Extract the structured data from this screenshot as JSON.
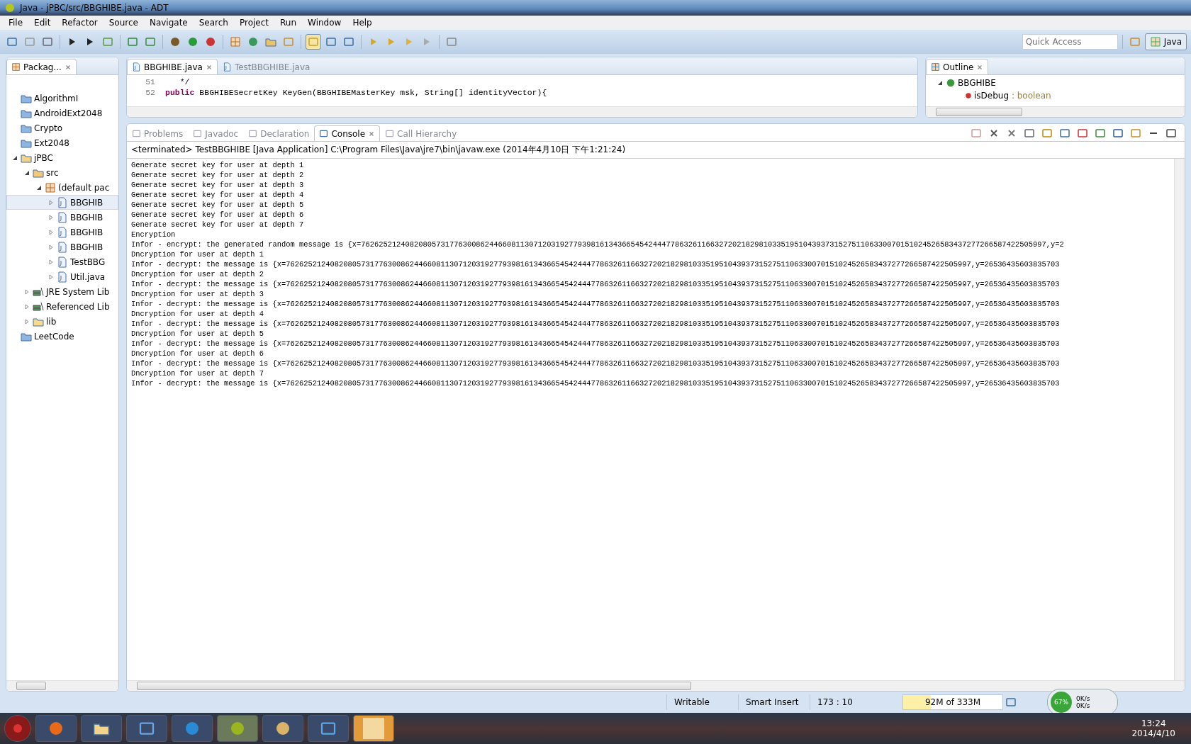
{
  "window": {
    "title": "Java - jPBC/src/BBGHIBE.java - ADT"
  },
  "menu": [
    "File",
    "Edit",
    "Refactor",
    "Source",
    "Navigate",
    "Search",
    "Project",
    "Run",
    "Window",
    "Help"
  ],
  "quick_access": {
    "placeholder": "Quick Access"
  },
  "perspective": {
    "label": "Java",
    "selected": true
  },
  "package_explorer": {
    "title": "Packag...",
    "tree": [
      {
        "label": "AlgorithmI",
        "kind": "project",
        "selected": false
      },
      {
        "label": "AndroidExt2048",
        "kind": "project",
        "selected": false
      },
      {
        "label": "Crypto",
        "kind": "project",
        "selected": false
      },
      {
        "label": "Ext2048",
        "kind": "project",
        "selected": false
      },
      {
        "label": "jPBC",
        "kind": "javaproject",
        "expanded": true,
        "selected": false,
        "children": [
          {
            "label": "src",
            "kind": "srcfolder",
            "expanded": true,
            "selected": false,
            "children": [
              {
                "label": "(default pac",
                "kind": "package",
                "expanded": true,
                "selected": false,
                "children": [
                  {
                    "label": "BBGHIB",
                    "kind": "java",
                    "expanded": false,
                    "selected": true
                  },
                  {
                    "label": "BBGHIB",
                    "kind": "java",
                    "expanded": false,
                    "selected": false
                  },
                  {
                    "label": "BBGHIB",
                    "kind": "java",
                    "expanded": false,
                    "selected": false
                  },
                  {
                    "label": "BBGHIB",
                    "kind": "java",
                    "expanded": false,
                    "selected": false
                  },
                  {
                    "label": "TestBBG",
                    "kind": "java",
                    "expanded": false,
                    "selected": false
                  },
                  {
                    "label": "Util.java",
                    "kind": "java",
                    "expanded": false,
                    "selected": false
                  }
                ]
              }
            ]
          },
          {
            "label": "JRE System Lib",
            "kind": "library",
            "expanded": false,
            "selected": false
          },
          {
            "label": "Referenced Lib",
            "kind": "library",
            "expanded": false,
            "selected": false
          },
          {
            "label": "lib",
            "kind": "folder",
            "expanded": false,
            "selected": false
          }
        ]
      },
      {
        "label": "LeetCode",
        "kind": "project",
        "selected": false
      }
    ]
  },
  "editor": {
    "tabs": [
      {
        "label": "BBGHIBE.java",
        "selected": true
      },
      {
        "label": "TestBBGHIBE.java",
        "selected": false
      }
    ],
    "lines": [
      {
        "number": "51",
        "code": "   */"
      },
      {
        "number": "52",
        "code": "**public** BBGHIBESecretKey KeyGen(BBGHIBEMasterKey msk, String[] identityVector){"
      }
    ]
  },
  "outline": {
    "title": "Outline",
    "tree": [
      {
        "label": "BBGHIBE",
        "kind": "class",
        "children": [
          {
            "label": "isDebug",
            "type": " : boolean",
            "kind": "field"
          }
        ]
      }
    ]
  },
  "console_panel": {
    "tabs": [
      {
        "label": "Problems",
        "selected": false
      },
      {
        "label": "Javadoc",
        "selected": false
      },
      {
        "label": "Declaration",
        "selected": false
      },
      {
        "label": "Console",
        "selected": true
      },
      {
        "label": "Call Hierarchy",
        "selected": false
      }
    ],
    "header": "<terminated> TestBBGHIBE [Java Application] C:\\Program Files\\Java\\jre7\\bin\\javaw.exe (2014年4月10日 下午1:21:24)",
    "lines": [
      "Generate secret key for user at depth 1",
      "Generate secret key for user at depth 2",
      "Generate secret key for user at depth 3",
      "Generate secret key for user at depth 4",
      "Generate secret key for user at depth 5",
      "Generate secret key for user at depth 6",
      "Generate secret key for user at depth 7",
      "Encryption",
      "Infor - encrypt: the generated random message is {x=76262521240820805731776300862446608113071203192779398161343665454244477863261166327202182981033519510439373152751106330070151024526583437277266587422505997,y=2",
      "Dncryption for user at depth 1",
      "Infor - decrypt: the message is {x=76262521240820805731776300862446608113071203192779398161343665454244477863261166327202182981033519510439373152751106330070151024526583437277266587422505997,y=26536435603835703",
      "Dncryption for user at depth 2",
      "Infor - decrypt: the message is {x=76262521240820805731776300862446608113071203192779398161343665454244477863261166327202182981033519510439373152751106330070151024526583437277266587422505997,y=26536435603835703",
      "Dncryption for user at depth 3",
      "Infor - decrypt: the message is {x=76262521240820805731776300862446608113071203192779398161343665454244477863261166327202182981033519510439373152751106330070151024526583437277266587422505997,y=26536435603835703",
      "Dncryption for user at depth 4",
      "Infor - decrypt: the message is {x=76262521240820805731776300862446608113071203192779398161343665454244477863261166327202182981033519510439373152751106330070151024526583437277266587422505997,y=26536435603835703",
      "Dncryption for user at depth 5",
      "Infor - decrypt: the message is {x=76262521240820805731776300862446608113071203192779398161343665454244477863261166327202182981033519510439373152751106330070151024526583437277266587422505997,y=26536435603835703",
      "Dncryption for user at depth 6",
      "Infor - decrypt: the message is {x=76262521240820805731776300862446608113071203192779398161343665454244477863261166327202182981033519510439373152751106330070151024526583437277266587422505997,y=26536435603835703",
      "Dncryption for user at depth 7",
      "Infor - decrypt: the message is {x=76262521240820805731776300862446608113071203192779398161343665454244477863261166327202182981033519510439373152751106330070151024526583437277266587422505997,y=26536435603835703"
    ]
  },
  "status_bar": {
    "mode": "Writable",
    "insert": "Smart Insert",
    "position": "173 : 10",
    "heap": {
      "label": "92M of 333M",
      "level": 0.28
    }
  },
  "net_widget": {
    "percent": "67%",
    "up": "0K/s",
    "down": "0K/s"
  },
  "taskbar": {
    "time": "13:24",
    "date": "2014/4/10"
  }
}
